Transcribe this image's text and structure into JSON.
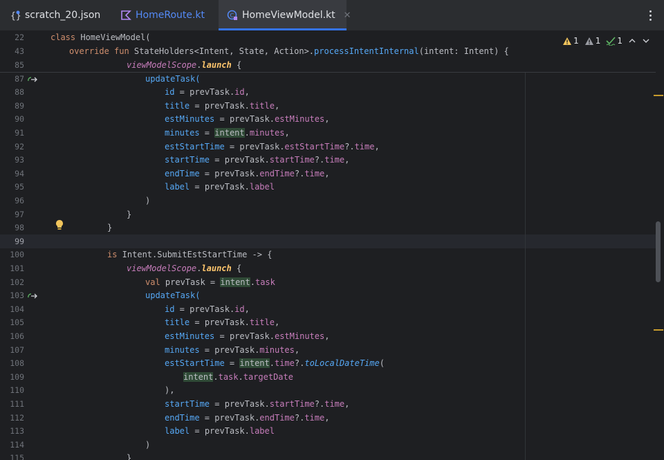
{
  "tabs": [
    {
      "label": "scratch_20.json",
      "icon": "json-file-icon"
    },
    {
      "label": "HomeRoute.kt",
      "icon": "kotlin-file-icon"
    },
    {
      "label": "HomeViewModel.kt",
      "icon": "kotlin-class-icon",
      "close": "✕"
    }
  ],
  "inspections": {
    "warnings": "1",
    "weak_warnings": "1",
    "typos": "1"
  },
  "sticky": {
    "l1_num": "22",
    "l1_kw": "class",
    "l1_rest": " HomeViewModel(",
    "l2_num": "43",
    "l2_kw": "override fun",
    "l2_a": " StateHolders<Intent, State, Action>.",
    "l2_fn": "processIntentInternal",
    "l2_b": "(intent: Intent) {",
    "l3_num": "85",
    "l3_scope": "viewModelScope",
    "l3_dot": ".",
    "l3_launch": "launch",
    "l3_rest": " {"
  },
  "lines": {
    "n87": "87",
    "n88": "88",
    "n89": "89",
    "n90": "90",
    "n91": "91",
    "n92": "92",
    "n93": "93",
    "n94": "94",
    "n95": "95",
    "n96": "96",
    "n97": "97",
    "n98": "98",
    "n99": "99",
    "n100": "100",
    "n101": "101",
    "n102": "102",
    "n103": "103",
    "n104": "104",
    "n105": "105",
    "n106": "106",
    "n107": "107",
    "n108": "108",
    "n109": "109",
    "n110": "110",
    "n111": "111",
    "n112": "112",
    "n113": "113",
    "n114": "114",
    "n115": "115"
  },
  "code": {
    "updateTask": "updateTask(",
    "id": "id",
    "eq": " = ",
    "prevTask": "prevTask.",
    "idProp": "id",
    "comma": ",",
    "title": "title",
    "titleProp": "title",
    "estMinutes": "estMinutes",
    "estMinutesProp": "estMinutes",
    "minutes": "minutes",
    "intent": "intent",
    "dot": ".",
    "minutesProp": "minutes",
    "estStartTime": "estStartTime",
    "estStartTimeProp": "estStartTime",
    "qdot": "?.",
    "time": "time",
    "startTime": "startTime",
    "startTimeProp": "startTime",
    "endTime": "endTime",
    "endTimeProp": "endTime",
    "label": "label",
    "labelProp": "label",
    "close_paren": ")",
    "close_brace": "}",
    "is": "is",
    "submitIntent": " Intent.SubmitEstStartTime -> {",
    "scope": "viewModelScope",
    "launch": "launch",
    "brace_open": " {",
    "val": "val",
    "prevTaskDecl": " prevTask = ",
    "task": "task",
    "toLocal": "toLocalDateTime",
    "paren_open": "(",
    "taskTarget": "task",
    "targetDate": "targetDate",
    "close_paren_comma": "),"
  }
}
